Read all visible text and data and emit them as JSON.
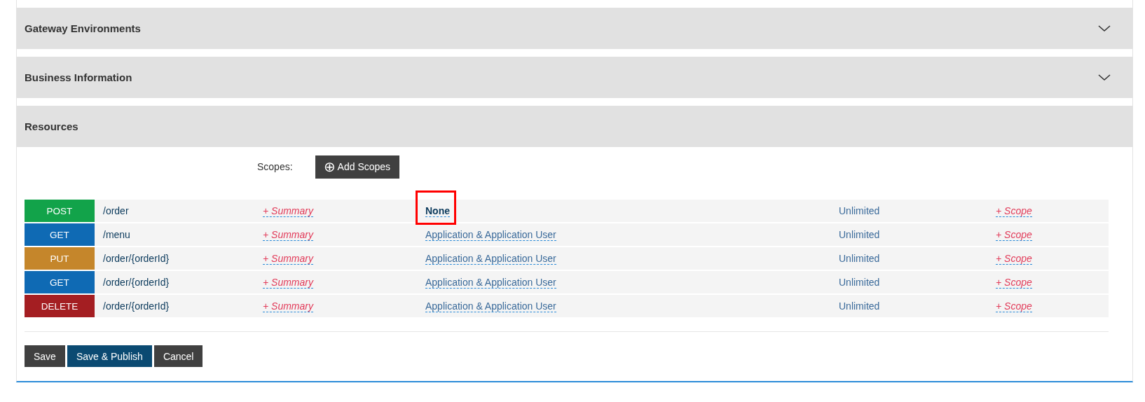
{
  "sections": [
    {
      "title": "Gateway Environments",
      "expanded": false
    },
    {
      "title": "Business Information",
      "expanded": false
    },
    {
      "title": "Resources",
      "expanded": true
    }
  ],
  "scopes": {
    "label": "Scopes:",
    "add_button": {
      "icon": "⊕",
      "label": "Add Scopes"
    }
  },
  "resources": [
    {
      "method": "POST",
      "color": "#12a34a",
      "path": "/order",
      "summary": "+ Summary",
      "auth": "None",
      "auth_bold": true,
      "highlighted": true,
      "throttling": "Unlimited",
      "scope": "+ Scope"
    },
    {
      "method": "GET",
      "color": "#0f6ab4",
      "path": "/menu",
      "summary": "+ Summary",
      "auth": "Application & Application User",
      "auth_bold": false,
      "highlighted": false,
      "throttling": "Unlimited",
      "scope": "+ Scope"
    },
    {
      "method": "PUT",
      "color": "#c5862b",
      "path": "/order/{orderId}",
      "summary": "+ Summary",
      "auth": "Application & Application User",
      "auth_bold": false,
      "highlighted": false,
      "throttling": "Unlimited",
      "scope": "+ Scope"
    },
    {
      "method": "GET",
      "color": "#0f6ab4",
      "path": "/order/{orderId}",
      "summary": "+ Summary",
      "auth": "Application & Application User",
      "auth_bold": false,
      "highlighted": false,
      "throttling": "Unlimited",
      "scope": "+ Scope"
    },
    {
      "method": "DELETE",
      "color": "#a41e22",
      "path": "/order/{orderId}",
      "summary": "+ Summary",
      "auth": "Application & Application User",
      "auth_bold": false,
      "highlighted": false,
      "throttling": "Unlimited",
      "scope": "+ Scope"
    }
  ],
  "buttons": [
    {
      "label": "Save",
      "kind": "default"
    },
    {
      "label": "Save & Publish",
      "kind": "primary"
    },
    {
      "label": "Cancel",
      "kind": "default"
    }
  ]
}
